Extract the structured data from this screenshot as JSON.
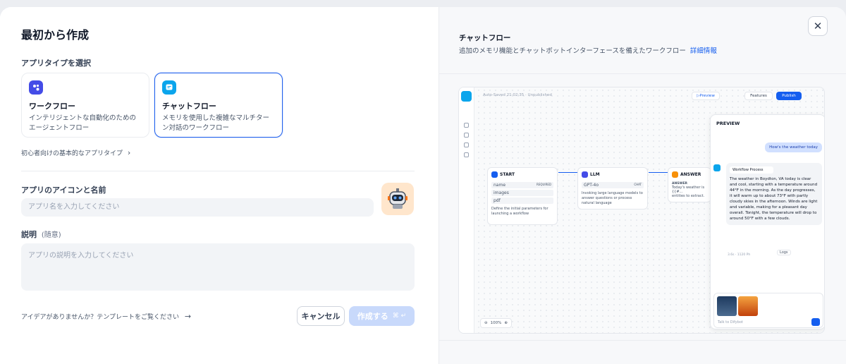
{
  "left": {
    "title": "最初から作成",
    "app_type_label": "アプリタイプを選択",
    "cards": [
      {
        "title": "ワークフロー",
        "desc": "インテリジェントな自動化のためのエージェントフロー",
        "icon": "workflow-icon",
        "color": "#444ce7"
      },
      {
        "title": "チャットフロー",
        "desc": "メモリを使用した複雑なマルチターン対話のワークフロー",
        "icon": "chatflow-icon",
        "color": "#0ba5ec"
      }
    ],
    "beginner_link": "初心者向けの基本的なアプリタイプ",
    "name_label": "アプリのアイコンと名前",
    "name_placeholder": "アプリ名を入力してください",
    "desc_label": "説明",
    "desc_optional": "(随意)",
    "desc_placeholder": "アプリの説明を入力してください",
    "idea_link": "アイデアがありませんか？テンプレートをご覧ください",
    "cancel": "キャンセル",
    "create": "作成する",
    "create_shortcut": "⌘ ↵"
  },
  "right": {
    "title": "チャットフロー",
    "desc": "追加のメモリ機能とチャットボットインターフェースを備えたワークフロー",
    "detail_link": "詳細情報"
  },
  "preview": {
    "autosave": "Auto-Saved 21:02:35 · Unpublished",
    "btn_preview": "Preview",
    "btn_features": "Features",
    "btn_publish": "Publish",
    "start": {
      "title": "START",
      "vars": [
        "name",
        "images",
        "pdf"
      ],
      "required": "REQUIRED",
      "desc": "Define the initial parameters for launching a workflow"
    },
    "llm": {
      "title": "LLM",
      "model": "GPT-4o",
      "mode": "CHAT",
      "desc": "Invoking large language models to answer questions or process natural language"
    },
    "answer": {
      "title": "ANSWER",
      "sub": "ANSWER",
      "text": "Today's weather is {{#...",
      "text2": "entities to extract."
    },
    "zoom": "100%",
    "chat": {
      "title": "PREVIEW",
      "user_msg": "How's the weather today",
      "process": "Workflow Process",
      "reply": "The weather in Boydton, VA today is clear and cool, starting with a temperature around 44°F in the morning. As the day progresses, it will warm up to about 73°F with partly cloudy skies in the afternoon. Winds are light and variable, making for a pleasant day overall. Tonight, the temperature will drop to around 50°F with a few clouds.",
      "meta": "3.6s · 1120 Ph",
      "logs": "Logs",
      "input_placeholder": "Talk to Difybot"
    }
  },
  "colors": {
    "accent": "#155eef",
    "selected_border": "#2563eb",
    "create_disabled": "#c8d9fb"
  }
}
